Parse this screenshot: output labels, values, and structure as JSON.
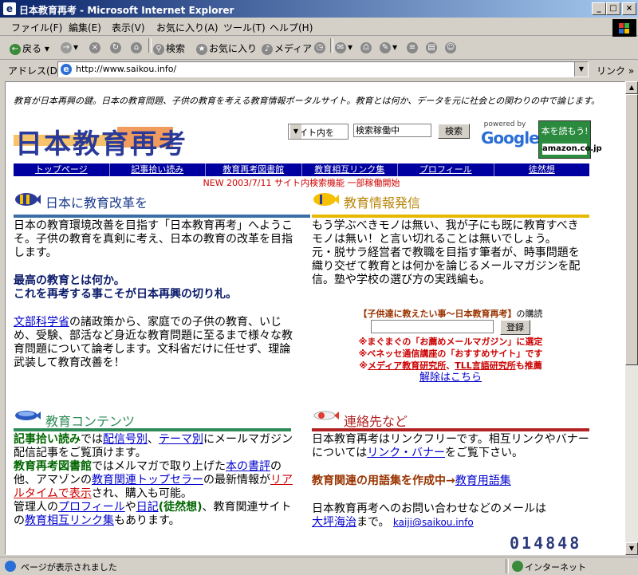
{
  "window": {
    "title": "日本教育再考 - Microsoft Internet Explorer",
    "buttons": [
      "_",
      "□",
      "×"
    ]
  },
  "menu": [
    "ファイル(F)",
    "編集(E)",
    "表示(V)",
    "お気に入り(A)",
    "ツール(T)",
    "ヘルプ(H)"
  ],
  "toolbar": {
    "back": "戻る",
    "search": "検索",
    "favorites": "お気に入り",
    "media": "メディア"
  },
  "address": {
    "label": "アドレス(D)",
    "url": "http://www.saikou.info/",
    "links": "リンク »"
  },
  "page": {
    "intro": "教育が日本再興の鍵。日本の教育問題、子供の教育を考える教育情報ポータルサイト。教育とは何か、データを元に社会との関わりの中で論じます。",
    "logo": "日本教育再考",
    "search": {
      "select": "サイト内を",
      "input": "検索稼働中",
      "button": "検索"
    },
    "google": {
      "powered": "powered by",
      "name": "Google"
    },
    "amazon": {
      "top": "本を読もう!",
      "name": "amazon.co.jp"
    },
    "nav": [
      "トップページ",
      "記事拾い読み",
      "教育再考図書館",
      "教育相互リンク集",
      "プロフィール",
      "徒然想"
    ],
    "news": "NEW 2003/7/11 サイト内検索機能 一部稼働開始",
    "sections": {
      "reform": {
        "title": "日本に教育改革を",
        "p1": "日本の教育環境改善を目指す「日本教育再考」へようこそ。子供の教育を真剣に考え、日本の教育の改革を目指します。",
        "bold1": "最高の教育とは何か。",
        "bold2": "これを再考する事こそが日本再興の切り札。",
        "link": "文部科学省",
        "p2": "の諸政策から、家庭での子供の教育、いじめ、受験、部活など身近な教育問題に至るまで様々な教育問題について論考します。文科省だけに任せず、理論武装して教育改善を！"
      },
      "info": {
        "title": "教育情報発信",
        "p1": "もう学ぶべきモノは無い、我が子にも既に教育すべきモノは無い！と言い切れることは無いでしょう。",
        "p2": "元・脱サラ経営者で教職を目指す筆者が、時事問題を織り交ぜて教育とは何かを論じるメールマガジンを配信。塾や学校の選び方の実践編も。",
        "mag_title": "【子供達に教えたい事～日本教育再考】",
        "mag_suffix": "の購読",
        "mag_button": "登録",
        "award1": "※まぐまぐの「お薦めメールマガジン」に選定",
        "award2": "※ベネッセ通信講座の「おすすめサイト」です",
        "award3_link1": "メディア教育研究所",
        "award3_sep": "、",
        "award3_link2": "TLL言語研究所",
        "award3_suffix": "も推薦",
        "pre3": "※",
        "unsubscribe": "解除はこちら"
      },
      "contents": {
        "title": "教育コンテンツ",
        "b1": "記事拾い読み",
        "t1": "では",
        "l1": "配信号別",
        "t2": "、",
        "l2": "テーマ別",
        "t3": "にメールマガジン配信記事をご覧頂けます。",
        "b2": "教育再考図書館",
        "t4": "ではメルマガで取り上げた",
        "l3": "本の書評",
        "t5": "の他、アマゾンの",
        "l4": "教育関連トップセラー",
        "t6": "の最新情報が",
        "l5": "リアルタイムで表示",
        "t7": "され、購入も可能。",
        "t8": "管理人の",
        "l6": "プロフィール",
        "t9": "や",
        "l7": "日記",
        "g1": "(徒然想)",
        "t10": "、教育関連サイトの",
        "l8": "教育相互リンク集",
        "t11": "もあります。"
      },
      "contact": {
        "title": "連絡先など",
        "p1a": "日本教育再考はリンクフリーです。相互リンクやバナーについては",
        "p1l": "リンク・バナー",
        "p1b": "をご覧下さい。",
        "b1": "教育関連の用語集を作成中→",
        "l1": "教育用語集",
        "p2": "日本教育再考へのお問い合わせなどのメールは",
        "l2": "大坪海治",
        "p2b": "まで。",
        "email": "kaiji@saikou.info"
      }
    },
    "counter": "014848"
  },
  "status": {
    "text": "ページが表示されました",
    "zone": "インターネット"
  },
  "colors": {
    "titlebar": "#0a246a",
    "nav": "#0000a0",
    "rule_blue": "#3a6ea5",
    "rule_gold": "#e6b800",
    "rule_green": "#2e8b57",
    "rule_red": "#b22222"
  }
}
